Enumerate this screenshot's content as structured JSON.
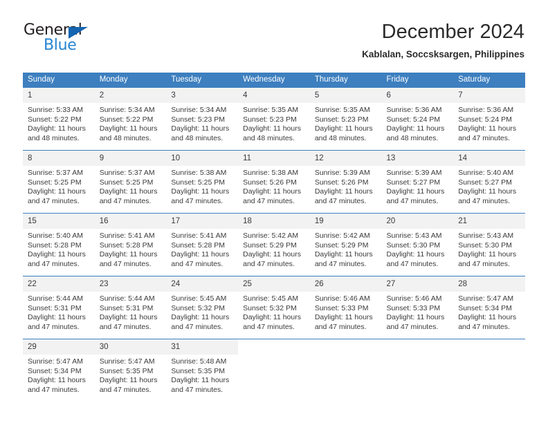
{
  "brand": {
    "name_top": "General",
    "name_bottom": "Blue",
    "color_dark": "#231f20",
    "color_blue": "#2585d3",
    "triangle_color": "#1565b0"
  },
  "header": {
    "title": "December 2024",
    "subtitle": "Kablalan, Soccsksargen, Philippines"
  },
  "theme": {
    "header_bg": "#3d7fbf",
    "header_text": "#ffffff",
    "daynum_bg": "#f2f2f2",
    "row_border": "#3d7fbf",
    "text": "#3a3a3a"
  },
  "weekdays": [
    "Sunday",
    "Monday",
    "Tuesday",
    "Wednesday",
    "Thursday",
    "Friday",
    "Saturday"
  ],
  "weeks": [
    [
      {
        "day": "1",
        "sunrise": "Sunrise: 5:33 AM",
        "sunset": "Sunset: 5:22 PM",
        "daylight_1": "Daylight: 11 hours",
        "daylight_2": "and 48 minutes."
      },
      {
        "day": "2",
        "sunrise": "Sunrise: 5:34 AM",
        "sunset": "Sunset: 5:22 PM",
        "daylight_1": "Daylight: 11 hours",
        "daylight_2": "and 48 minutes."
      },
      {
        "day": "3",
        "sunrise": "Sunrise: 5:34 AM",
        "sunset": "Sunset: 5:23 PM",
        "daylight_1": "Daylight: 11 hours",
        "daylight_2": "and 48 minutes."
      },
      {
        "day": "4",
        "sunrise": "Sunrise: 5:35 AM",
        "sunset": "Sunset: 5:23 PM",
        "daylight_1": "Daylight: 11 hours",
        "daylight_2": "and 48 minutes."
      },
      {
        "day": "5",
        "sunrise": "Sunrise: 5:35 AM",
        "sunset": "Sunset: 5:23 PM",
        "daylight_1": "Daylight: 11 hours",
        "daylight_2": "and 48 minutes."
      },
      {
        "day": "6",
        "sunrise": "Sunrise: 5:36 AM",
        "sunset": "Sunset: 5:24 PM",
        "daylight_1": "Daylight: 11 hours",
        "daylight_2": "and 48 minutes."
      },
      {
        "day": "7",
        "sunrise": "Sunrise: 5:36 AM",
        "sunset": "Sunset: 5:24 PM",
        "daylight_1": "Daylight: 11 hours",
        "daylight_2": "and 47 minutes."
      }
    ],
    [
      {
        "day": "8",
        "sunrise": "Sunrise: 5:37 AM",
        "sunset": "Sunset: 5:25 PM",
        "daylight_1": "Daylight: 11 hours",
        "daylight_2": "and 47 minutes."
      },
      {
        "day": "9",
        "sunrise": "Sunrise: 5:37 AM",
        "sunset": "Sunset: 5:25 PM",
        "daylight_1": "Daylight: 11 hours",
        "daylight_2": "and 47 minutes."
      },
      {
        "day": "10",
        "sunrise": "Sunrise: 5:38 AM",
        "sunset": "Sunset: 5:25 PM",
        "daylight_1": "Daylight: 11 hours",
        "daylight_2": "and 47 minutes."
      },
      {
        "day": "11",
        "sunrise": "Sunrise: 5:38 AM",
        "sunset": "Sunset: 5:26 PM",
        "daylight_1": "Daylight: 11 hours",
        "daylight_2": "and 47 minutes."
      },
      {
        "day": "12",
        "sunrise": "Sunrise: 5:39 AM",
        "sunset": "Sunset: 5:26 PM",
        "daylight_1": "Daylight: 11 hours",
        "daylight_2": "and 47 minutes."
      },
      {
        "day": "13",
        "sunrise": "Sunrise: 5:39 AM",
        "sunset": "Sunset: 5:27 PM",
        "daylight_1": "Daylight: 11 hours",
        "daylight_2": "and 47 minutes."
      },
      {
        "day": "14",
        "sunrise": "Sunrise: 5:40 AM",
        "sunset": "Sunset: 5:27 PM",
        "daylight_1": "Daylight: 11 hours",
        "daylight_2": "and 47 minutes."
      }
    ],
    [
      {
        "day": "15",
        "sunrise": "Sunrise: 5:40 AM",
        "sunset": "Sunset: 5:28 PM",
        "daylight_1": "Daylight: 11 hours",
        "daylight_2": "and 47 minutes."
      },
      {
        "day": "16",
        "sunrise": "Sunrise: 5:41 AM",
        "sunset": "Sunset: 5:28 PM",
        "daylight_1": "Daylight: 11 hours",
        "daylight_2": "and 47 minutes."
      },
      {
        "day": "17",
        "sunrise": "Sunrise: 5:41 AM",
        "sunset": "Sunset: 5:28 PM",
        "daylight_1": "Daylight: 11 hours",
        "daylight_2": "and 47 minutes."
      },
      {
        "day": "18",
        "sunrise": "Sunrise: 5:42 AM",
        "sunset": "Sunset: 5:29 PM",
        "daylight_1": "Daylight: 11 hours",
        "daylight_2": "and 47 minutes."
      },
      {
        "day": "19",
        "sunrise": "Sunrise: 5:42 AM",
        "sunset": "Sunset: 5:29 PM",
        "daylight_1": "Daylight: 11 hours",
        "daylight_2": "and 47 minutes."
      },
      {
        "day": "20",
        "sunrise": "Sunrise: 5:43 AM",
        "sunset": "Sunset: 5:30 PM",
        "daylight_1": "Daylight: 11 hours",
        "daylight_2": "and 47 minutes."
      },
      {
        "day": "21",
        "sunrise": "Sunrise: 5:43 AM",
        "sunset": "Sunset: 5:30 PM",
        "daylight_1": "Daylight: 11 hours",
        "daylight_2": "and 47 minutes."
      }
    ],
    [
      {
        "day": "22",
        "sunrise": "Sunrise: 5:44 AM",
        "sunset": "Sunset: 5:31 PM",
        "daylight_1": "Daylight: 11 hours",
        "daylight_2": "and 47 minutes."
      },
      {
        "day": "23",
        "sunrise": "Sunrise: 5:44 AM",
        "sunset": "Sunset: 5:31 PM",
        "daylight_1": "Daylight: 11 hours",
        "daylight_2": "and 47 minutes."
      },
      {
        "day": "24",
        "sunrise": "Sunrise: 5:45 AM",
        "sunset": "Sunset: 5:32 PM",
        "daylight_1": "Daylight: 11 hours",
        "daylight_2": "and 47 minutes."
      },
      {
        "day": "25",
        "sunrise": "Sunrise: 5:45 AM",
        "sunset": "Sunset: 5:32 PM",
        "daylight_1": "Daylight: 11 hours",
        "daylight_2": "and 47 minutes."
      },
      {
        "day": "26",
        "sunrise": "Sunrise: 5:46 AM",
        "sunset": "Sunset: 5:33 PM",
        "daylight_1": "Daylight: 11 hours",
        "daylight_2": "and 47 minutes."
      },
      {
        "day": "27",
        "sunrise": "Sunrise: 5:46 AM",
        "sunset": "Sunset: 5:33 PM",
        "daylight_1": "Daylight: 11 hours",
        "daylight_2": "and 47 minutes."
      },
      {
        "day": "28",
        "sunrise": "Sunrise: 5:47 AM",
        "sunset": "Sunset: 5:34 PM",
        "daylight_1": "Daylight: 11 hours",
        "daylight_2": "and 47 minutes."
      }
    ],
    [
      {
        "day": "29",
        "sunrise": "Sunrise: 5:47 AM",
        "sunset": "Sunset: 5:34 PM",
        "daylight_1": "Daylight: 11 hours",
        "daylight_2": "and 47 minutes."
      },
      {
        "day": "30",
        "sunrise": "Sunrise: 5:47 AM",
        "sunset": "Sunset: 5:35 PM",
        "daylight_1": "Daylight: 11 hours",
        "daylight_2": "and 47 minutes."
      },
      {
        "day": "31",
        "sunrise": "Sunrise: 5:48 AM",
        "sunset": "Sunset: 5:35 PM",
        "daylight_1": "Daylight: 11 hours",
        "daylight_2": "and 47 minutes."
      },
      null,
      null,
      null,
      null
    ]
  ]
}
